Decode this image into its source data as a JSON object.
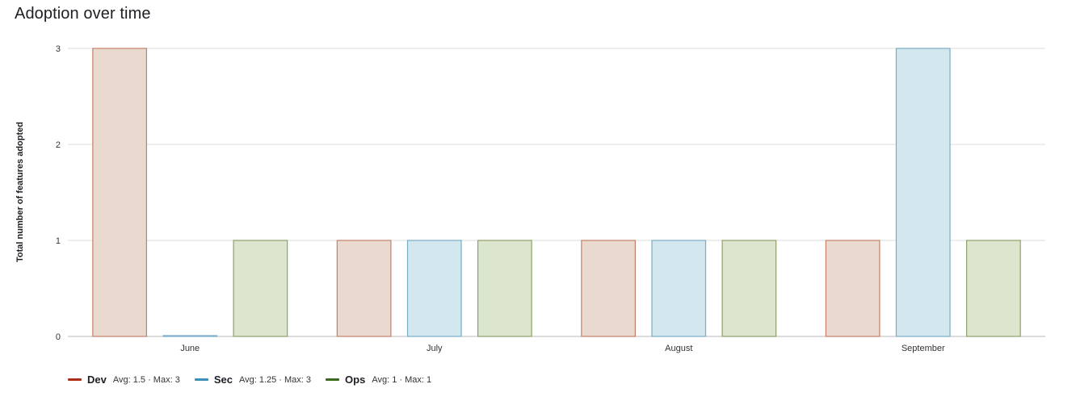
{
  "title": "Adoption over time",
  "colors": {
    "Dev": {
      "stroke": "#c4806a",
      "fill": "#ead9cf",
      "legend": "#ab2e14"
    },
    "Sec": {
      "stroke": "#7aacc8",
      "fill": "#d3e7ee",
      "legend": "#3e8fb8"
    },
    "Ops": {
      "stroke": "#8fa06a",
      "fill": "#dce6cf",
      "legend": "#3b6a1e"
    },
    "gridline": "#dcdcde",
    "axis": "#b8b8bb"
  },
  "legend": [
    {
      "name": "Dev",
      "stats": "Avg: 1.5 · Max: 3"
    },
    {
      "name": "Sec",
      "stats": "Avg: 1.25 · Max: 3"
    },
    {
      "name": "Ops",
      "stats": "Avg: 1 · Max: 1"
    }
  ],
  "chart_data": {
    "type": "bar",
    "title": "Adoption over time",
    "xlabel": "",
    "ylabel": "Total number of features adopted",
    "categories": [
      "June",
      "July",
      "August",
      "September"
    ],
    "series": [
      {
        "name": "Dev",
        "values": [
          3,
          1,
          1,
          1
        ]
      },
      {
        "name": "Sec",
        "values": [
          0,
          1,
          1,
          3
        ]
      },
      {
        "name": "Ops",
        "values": [
          1,
          1,
          1,
          1
        ]
      }
    ],
    "ylim": [
      0,
      3
    ],
    "yticks": [
      0,
      1,
      2,
      3
    ],
    "grid": true,
    "legend_position": "bottom-left"
  }
}
